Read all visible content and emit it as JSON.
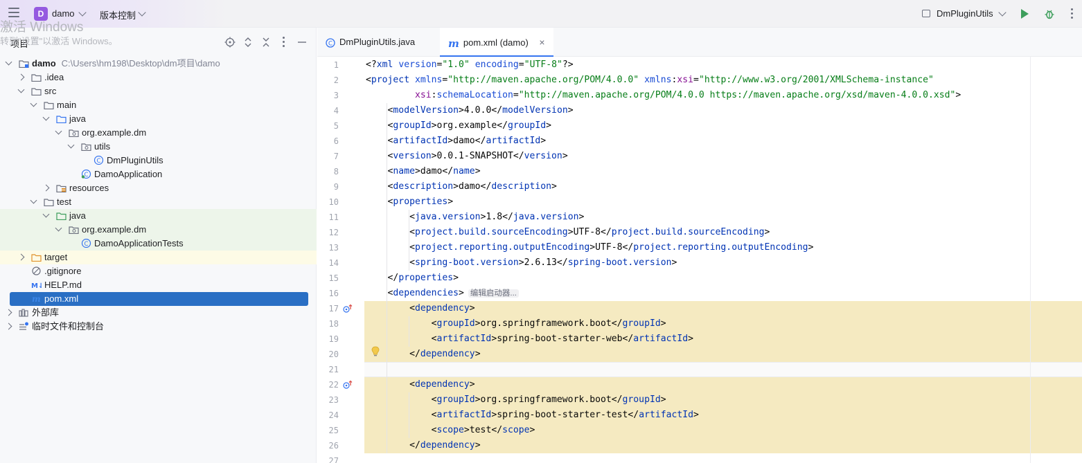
{
  "topbar": {
    "menu_icon": "hamburger-icon",
    "project_badge": "D",
    "project_name": "damo",
    "vcs_label": "版本控制",
    "watermark_line1": "激活 Windows",
    "watermark_line2": "转到\"设置\"以激活 Windows。",
    "run_config": "DmPluginUtils",
    "icons": [
      "run-icon",
      "debug-icon",
      "more-icon"
    ],
    "colors": {
      "project_badge": "#955ae0",
      "run": "#3e9e5c",
      "debug": "#3e9e5c",
      "accent": "#2a6fc4"
    }
  },
  "project_panel": {
    "title": "项目",
    "tool_icons": [
      "crosshair-icon",
      "expand-all-icon",
      "collapse-all-icon",
      "more-icon",
      "minimize-icon"
    ],
    "tree": [
      {
        "label": "damo",
        "path": "C:\\Users\\hm198\\Desktop\\dm项目\\damo",
        "depth": 0,
        "arrow": "open",
        "icon": "module-folder-icon",
        "bold": true
      },
      {
        "label": ".idea",
        "depth": 1,
        "arrow": "closed",
        "icon": "folder-icon"
      },
      {
        "label": "src",
        "depth": 1,
        "arrow": "open",
        "icon": "folder-icon"
      },
      {
        "label": "main",
        "depth": 2,
        "arrow": "open",
        "icon": "folder-icon"
      },
      {
        "label": "java",
        "depth": 3,
        "arrow": "open",
        "icon": "source-folder-icon"
      },
      {
        "label": "org.example.dm",
        "depth": 4,
        "arrow": "open",
        "icon": "package-icon"
      },
      {
        "label": "utils",
        "depth": 5,
        "arrow": "open",
        "icon": "package-icon"
      },
      {
        "label": "DmPluginUtils",
        "depth": 6,
        "arrow": "none",
        "icon": "class-icon"
      },
      {
        "label": "DamoApplication",
        "depth": 5,
        "arrow": "none",
        "icon": "spring-class-icon"
      },
      {
        "label": "resources",
        "depth": 3,
        "arrow": "closed",
        "icon": "resources-folder-icon"
      },
      {
        "label": "test",
        "depth": 2,
        "arrow": "open",
        "icon": "folder-icon"
      },
      {
        "label": "java",
        "depth": 3,
        "arrow": "open",
        "icon": "test-folder-icon",
        "bg": "test"
      },
      {
        "label": "org.example.dm",
        "depth": 4,
        "arrow": "open",
        "icon": "package-icon",
        "bg": "test"
      },
      {
        "label": "DamoApplicationTests",
        "depth": 5,
        "arrow": "none",
        "icon": "class-icon",
        "bg": "test"
      },
      {
        "label": "target",
        "depth": 1,
        "arrow": "closed",
        "icon": "excluded-folder-icon",
        "bg": "excluded"
      },
      {
        "label": ".gitignore",
        "depth": 1,
        "arrow": "none",
        "icon": "ignore-file-icon"
      },
      {
        "label": "HELP.md",
        "depth": 1,
        "arrow": "none",
        "icon": "markdown-icon"
      },
      {
        "label": "pom.xml",
        "depth": 1,
        "arrow": "none",
        "icon": "maven-icon",
        "selected": true
      },
      {
        "label": "外部库",
        "depth": 0,
        "arrow": "closed",
        "icon": "library-icon"
      },
      {
        "label": "临时文件和控制台",
        "depth": 0,
        "arrow": "closed",
        "icon": "scratch-icon"
      }
    ]
  },
  "editor": {
    "tabs": [
      {
        "label": "DmPluginUtils.java",
        "icon": "class-icon",
        "active": false
      },
      {
        "label": "pom.xml (damo)",
        "icon": "maven-icon",
        "active": true,
        "close": "×"
      }
    ],
    "inlay_hint": "编辑启动器...",
    "lines": [
      {
        "n": "1",
        "tokens": [
          [
            "p",
            "<?"
          ],
          [
            "t",
            "xml "
          ],
          [
            "a",
            "version"
          ],
          [
            "p",
            "="
          ],
          [
            "v",
            "\"1.0\" "
          ],
          [
            "a",
            "encoding"
          ],
          [
            "p",
            "="
          ],
          [
            "v",
            "\"UTF-8\""
          ],
          [
            "p",
            "?>"
          ]
        ]
      },
      {
        "n": "2",
        "tokens": [
          [
            "p",
            "<"
          ],
          [
            "t",
            "project "
          ],
          [
            "a",
            "xmlns"
          ],
          [
            "p",
            "="
          ],
          [
            "v",
            "\"http://maven.apache.org/POM/4.0.0\" "
          ],
          [
            "a",
            "xmlns"
          ],
          [
            "p",
            ":"
          ],
          [
            "ns",
            "xsi"
          ],
          [
            "p",
            "="
          ],
          [
            "v",
            "\"http://www.w3.org/2001/XMLSchema-instance\""
          ]
        ]
      },
      {
        "n": "3",
        "tokens": [
          [
            "p",
            "         "
          ],
          [
            "ns",
            "xsi"
          ],
          [
            "p",
            ":"
          ],
          [
            "a",
            "schemaLocation"
          ],
          [
            "p",
            "="
          ],
          [
            "v",
            "\"http://maven.apache.org/POM/4.0.0 https://maven.apache.org/xsd/maven-4.0.0.xsd\""
          ],
          [
            "p",
            ">"
          ]
        ]
      },
      {
        "n": "4",
        "tokens": [
          [
            "p",
            "    <"
          ],
          [
            "t",
            "modelVersion"
          ],
          [
            "p",
            ">4.0.0</"
          ],
          [
            "t",
            "modelVersion"
          ],
          [
            "p",
            ">"
          ]
        ]
      },
      {
        "n": "5",
        "tokens": [
          [
            "p",
            "    <"
          ],
          [
            "t",
            "groupId"
          ],
          [
            "p",
            ">org.example</"
          ],
          [
            "t",
            "groupId"
          ],
          [
            "p",
            ">"
          ]
        ]
      },
      {
        "n": "6",
        "tokens": [
          [
            "p",
            "    <"
          ],
          [
            "t",
            "artifactId"
          ],
          [
            "p",
            ">damo</"
          ],
          [
            "t",
            "artifactId"
          ],
          [
            "p",
            ">"
          ]
        ]
      },
      {
        "n": "7",
        "tokens": [
          [
            "p",
            "    <"
          ],
          [
            "t",
            "version"
          ],
          [
            "p",
            ">0.0.1-SNAPSHOT</"
          ],
          [
            "t",
            "version"
          ],
          [
            "p",
            ">"
          ]
        ]
      },
      {
        "n": "8",
        "tokens": [
          [
            "p",
            "    <"
          ],
          [
            "t",
            "name"
          ],
          [
            "p",
            ">damo</"
          ],
          [
            "t",
            "name"
          ],
          [
            "p",
            ">"
          ]
        ]
      },
      {
        "n": "9",
        "tokens": [
          [
            "p",
            "    <"
          ],
          [
            "t",
            "description"
          ],
          [
            "p",
            ">damo</"
          ],
          [
            "t",
            "description"
          ],
          [
            "p",
            ">"
          ]
        ]
      },
      {
        "n": "10",
        "tokens": [
          [
            "p",
            "    <"
          ],
          [
            "t",
            "properties"
          ],
          [
            "p",
            ">"
          ]
        ]
      },
      {
        "n": "11",
        "tokens": [
          [
            "p",
            "        <"
          ],
          [
            "t",
            "java.version"
          ],
          [
            "p",
            ">1.8</"
          ],
          [
            "t",
            "java.version"
          ],
          [
            "p",
            ">"
          ]
        ]
      },
      {
        "n": "12",
        "tokens": [
          [
            "p",
            "        <"
          ],
          [
            "t",
            "project.build.sourceEncoding"
          ],
          [
            "p",
            ">UTF-8</"
          ],
          [
            "t",
            "project.build.sourceEncoding"
          ],
          [
            "p",
            ">"
          ]
        ]
      },
      {
        "n": "13",
        "tokens": [
          [
            "p",
            "        <"
          ],
          [
            "t",
            "project.reporting.outputEncoding"
          ],
          [
            "p",
            ">UTF-8</"
          ],
          [
            "t",
            "project.reporting.outputEncoding"
          ],
          [
            "p",
            ">"
          ]
        ]
      },
      {
        "n": "14",
        "tokens": [
          [
            "p",
            "        <"
          ],
          [
            "t",
            "spring-boot.version"
          ],
          [
            "p",
            ">2.6.13</"
          ],
          [
            "t",
            "spring-boot.version"
          ],
          [
            "p",
            ">"
          ]
        ]
      },
      {
        "n": "15",
        "tokens": [
          [
            "p",
            "    </"
          ],
          [
            "t",
            "properties"
          ],
          [
            "p",
            ">"
          ]
        ]
      },
      {
        "n": "16",
        "tokens": [
          [
            "p",
            "    <"
          ],
          [
            "t",
            "dependencies"
          ],
          [
            "p",
            ">"
          ],
          [
            "hint",
            ""
          ]
        ]
      },
      {
        "n": "17",
        "hl": true,
        "gutter": "maven-dependency-icon",
        "tokens": [
          [
            "p",
            "        <"
          ],
          [
            "t",
            "dependency"
          ],
          [
            "p",
            ">"
          ]
        ]
      },
      {
        "n": "18",
        "hl": true,
        "tokens": [
          [
            "p",
            "            <"
          ],
          [
            "t",
            "groupId"
          ],
          [
            "p",
            ">org.springframework.boot</"
          ],
          [
            "t",
            "groupId"
          ],
          [
            "p",
            ">"
          ]
        ]
      },
      {
        "n": "19",
        "hl": true,
        "tokens": [
          [
            "p",
            "            <"
          ],
          [
            "t",
            "artifactId"
          ],
          [
            "p",
            ">spring-boot-starter-web</"
          ],
          [
            "t",
            "artifactId"
          ],
          [
            "p",
            ">"
          ]
        ]
      },
      {
        "n": "20",
        "hl": true,
        "tokens": [
          [
            "p",
            "        </"
          ],
          [
            "t",
            "dependency"
          ],
          [
            "p",
            ">"
          ]
        ]
      },
      {
        "n": "21",
        "cur": true,
        "tokens": []
      },
      {
        "n": "22",
        "hl": true,
        "gutter": "maven-dependency-icon",
        "tokens": [
          [
            "p",
            "        <"
          ],
          [
            "t",
            "dependency"
          ],
          [
            "p",
            ">"
          ]
        ]
      },
      {
        "n": "23",
        "hl": true,
        "tokens": [
          [
            "p",
            "            <"
          ],
          [
            "t",
            "groupId"
          ],
          [
            "p",
            ">org.springframework.boot</"
          ],
          [
            "t",
            "groupId"
          ],
          [
            "p",
            ">"
          ]
        ]
      },
      {
        "n": "24",
        "hl": true,
        "tokens": [
          [
            "p",
            "            <"
          ],
          [
            "t",
            "artifactId"
          ],
          [
            "p",
            ">spring-boot-starter-test</"
          ],
          [
            "t",
            "artifactId"
          ],
          [
            "p",
            ">"
          ]
        ]
      },
      {
        "n": "25",
        "hl": true,
        "tokens": [
          [
            "p",
            "            <"
          ],
          [
            "t",
            "scope"
          ],
          [
            "p",
            ">test</"
          ],
          [
            "t",
            "scope"
          ],
          [
            "p",
            ">"
          ]
        ]
      },
      {
        "n": "26",
        "hl": true,
        "tokens": [
          [
            "p",
            "        </"
          ],
          [
            "t",
            "dependency"
          ],
          [
            "p",
            ">"
          ]
        ]
      },
      {
        "n": "27",
        "tokens": []
      }
    ]
  }
}
